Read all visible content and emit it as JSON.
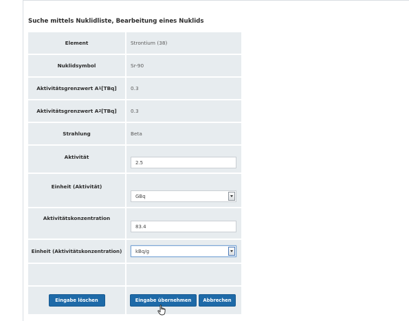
{
  "heading": "Suche mittels Nuklidliste, Bearbeitung eines Nuklids",
  "rows": {
    "element": {
      "label": "Element",
      "value": "Strontium (38)"
    },
    "nuklidsymbol": {
      "label": "Nuklidsymbol",
      "value": "Sr-90"
    },
    "a1": {
      "label_pre": "Aktivitätsgrenzwert A",
      "label_sub": "1",
      "label_post": " [TBq]",
      "value": "0.3"
    },
    "a2": {
      "label_pre": "Aktivitätsgrenzwert A",
      "label_sub": "2",
      "label_post": " [TBq]",
      "value": "0.3"
    },
    "strahlung": {
      "label": "Strahlung",
      "value": "Beta"
    },
    "aktivitaet": {
      "label": "Aktivität",
      "value": "2.5"
    },
    "einheit_aktivitaet": {
      "label": "Einheit (Aktivität)",
      "value": "GBq"
    },
    "aktivitaetskonzentration": {
      "label": "Aktivitätskonzentration",
      "value": "83.4"
    },
    "einheit_konzentration": {
      "label": "Einheit (Aktivitätskonzentration)",
      "value": "kBq/g"
    }
  },
  "buttons": {
    "clear": "Eingabe löschen",
    "apply": "Eingabe übernehmen",
    "cancel": "Abbrechen"
  },
  "icons": {
    "dropdown": "chevron-down-icon",
    "cursor": "hand-pointer-icon"
  },
  "colors": {
    "row_bg": "#e7ecef",
    "button_bg": "#1e6aa8",
    "button_text": "#ffffff"
  }
}
